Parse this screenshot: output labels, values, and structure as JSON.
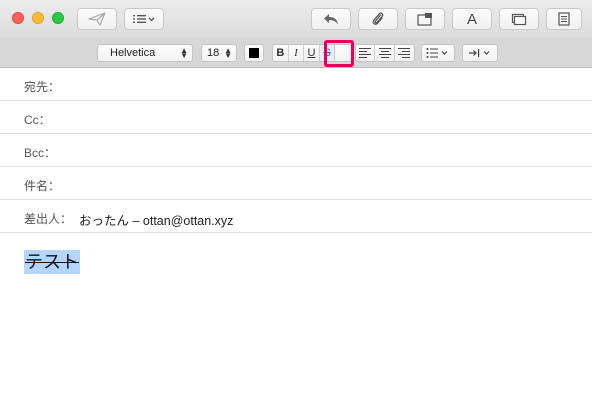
{
  "toolbar": {
    "send_icon": "send-icon",
    "header_fields_icon": "list-icon",
    "reply_icon": "reply-arrow-icon",
    "attach_icon": "paperclip-icon",
    "markup_icon": "photo-browser-icon",
    "fonts_label": "A",
    "window_icon": "window-icon",
    "format_icon": "format-icon"
  },
  "formatbar": {
    "font_family": "Helvetica",
    "font_size": "18",
    "text_color": "#000000",
    "bold_label": "B",
    "italic_label": "I",
    "underline_label": "U",
    "strikethrough_label": "S",
    "highlight_color": "#e8005c"
  },
  "fields": {
    "to_label": "宛先：",
    "cc_label": "Cc：",
    "bcc_label": "Bcc：",
    "subject_label": "件名：",
    "from_label": "差出人：",
    "from_value": "おったん – ottan@ottan.xyz"
  },
  "body": {
    "text": "テスト",
    "selection_color": "#b4d5fe"
  }
}
